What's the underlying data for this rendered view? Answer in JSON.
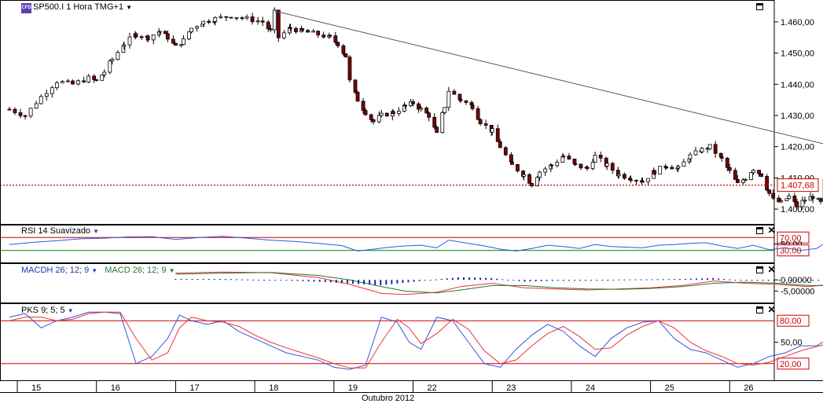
{
  "chart_data": [
    {
      "type": "candlestick",
      "title": "SP500.I 1 Hora TMG+1",
      "ylim": [
        1396,
        1465
      ],
      "y_ticks": [
        "1.460,00",
        "1.450,00",
        "1.440,00",
        "1.430,00",
        "1.420,00",
        "1.410,00",
        "1.400,00"
      ],
      "y_tick_values": [
        1460,
        1450,
        1440,
        1430,
        1420,
        1410,
        1400
      ],
      "last_price": 1407.68,
      "last_price_label": "1.407,68",
      "trendline": [
        [
          18.25,
          1463.5
        ],
        [
          26.8,
          1411
        ]
      ],
      "colors": {
        "bull": "#ffffff",
        "bear": "#7a0000",
        "wick": "#000000",
        "last_price": "#cc0000",
        "trendline": "#555555"
      },
      "close_path": [
        [
          14.9,
          1432
        ],
        [
          15.1,
          1430
        ],
        [
          15.3,
          1436
        ],
        [
          15.5,
          1441
        ],
        [
          15.7,
          1440
        ],
        [
          15.9,
          1442
        ],
        [
          16.0,
          1441
        ],
        [
          16.1,
          1444
        ],
        [
          16.2,
          1448
        ],
        [
          16.35,
          1453
        ],
        [
          16.5,
          1456
        ],
        [
          16.65,
          1455
        ],
        [
          16.8,
          1457
        ],
        [
          16.9,
          1455
        ],
        [
          17.0,
          1452
        ],
        [
          17.1,
          1454
        ],
        [
          17.2,
          1458
        ],
        [
          17.35,
          1460
        ],
        [
          17.5,
          1461
        ],
        [
          17.7,
          1462
        ],
        [
          17.9,
          1461
        ],
        [
          18.1,
          1460
        ],
        [
          18.2,
          1457
        ],
        [
          18.25,
          1463
        ],
        [
          18.3,
          1455
        ],
        [
          18.45,
          1458
        ],
        [
          18.6,
          1457
        ],
        [
          18.8,
          1456
        ],
        [
          18.95,
          1455
        ],
        [
          19.05,
          1453
        ],
        [
          19.15,
          1449
        ],
        [
          19.2,
          1441
        ],
        [
          19.3,
          1435
        ],
        [
          19.4,
          1431
        ],
        [
          19.5,
          1428
        ],
        [
          19.6,
          1430
        ],
        [
          19.75,
          1431
        ],
        [
          19.9,
          1433
        ],
        [
          20.0,
          1434
        ],
        [
          20.1,
          1432
        ],
        [
          20.2,
          1430
        ],
        [
          20.3,
          1424
        ],
        [
          20.4,
          1433
        ],
        [
          20.45,
          1438
        ],
        [
          20.6,
          1435
        ],
        [
          20.75,
          1433
        ],
        [
          20.85,
          1428
        ],
        [
          21.0,
          1425
        ],
        [
          21.1,
          1420
        ],
        [
          21.25,
          1414
        ],
        [
          21.4,
          1411
        ],
        [
          21.5,
          1408
        ],
        [
          21.6,
          1412
        ],
        [
          21.75,
          1414
        ],
        [
          21.9,
          1417
        ],
        [
          22.05,
          1414
        ],
        [
          22.2,
          1413
        ],
        [
          22.3,
          1417
        ],
        [
          22.45,
          1414
        ],
        [
          22.6,
          1411
        ],
        [
          22.75,
          1410
        ],
        [
          22.9,
          1409
        ],
        [
          23.05,
          1412
        ],
        [
          23.2,
          1414
        ],
        [
          23.35,
          1413
        ],
        [
          23.5,
          1417
        ],
        [
          23.65,
          1419
        ],
        [
          23.75,
          1420
        ],
        [
          23.9,
          1416
        ],
        [
          24.0,
          1412
        ],
        [
          24.1,
          1408
        ],
        [
          24.2,
          1410
        ],
        [
          24.3,
          1413
        ],
        [
          24.4,
          1411
        ],
        [
          24.5,
          1405
        ],
        [
          24.55,
          1403
        ],
        [
          24.65,
          1402
        ],
        [
          24.75,
          1404
        ],
        [
          24.85,
          1401
        ],
        [
          24.95,
          1403
        ],
        [
          25.05,
          1404
        ],
        [
          25.15,
          1402
        ],
        [
          25.2,
          1409
        ],
        [
          25.3,
          1412
        ],
        [
          25.4,
          1407
        ],
        [
          25.45,
          1408
        ]
      ]
    },
    {
      "type": "line",
      "title": "RSI 14 Suavizado",
      "ylim": [
        0,
        100
      ],
      "y_ticks": [
        "70,00",
        "50,00",
        "30,00"
      ],
      "y_tick_values": [
        70,
        50,
        30
      ],
      "ref_lines": [
        {
          "value": 70,
          "color": "#cc0000"
        },
        {
          "value": 30,
          "color": "#008000"
        }
      ],
      "series": [
        {
          "name": "RSI",
          "color": "#3355dd",
          "x": [
            14.9,
            15.2,
            15.5,
            15.8,
            16.1,
            16.4,
            16.7,
            17.0,
            17.3,
            17.6,
            17.9,
            18.2,
            18.5,
            18.8,
            19.1,
            19.3,
            19.5,
            19.7,
            19.9,
            20.1,
            20.3,
            20.45,
            20.7,
            20.9,
            21.1,
            21.3,
            21.5,
            21.7,
            21.9,
            22.1,
            22.3,
            22.5,
            22.7,
            22.9,
            23.1,
            23.3,
            23.5,
            23.7,
            23.9,
            24.1,
            24.3,
            24.5,
            24.7,
            24.9,
            25.1,
            25.25,
            25.45
          ],
          "values": [
            48,
            55,
            60,
            66,
            68,
            72,
            73,
            64,
            70,
            74,
            68,
            62,
            58,
            52,
            45,
            28,
            34,
            40,
            44,
            46,
            38,
            62,
            52,
            44,
            34,
            28,
            36,
            46,
            42,
            36,
            48,
            42,
            40,
            38,
            46,
            48,
            52,
            54,
            44,
            36,
            46,
            32,
            38,
            30,
            36,
            60,
            52
          ]
        }
      ]
    },
    {
      "type": "line",
      "title": "MACDH 26; 12; 9",
      "title2": "MACD 26; 12; 9",
      "ylim": [
        -9,
        6
      ],
      "y_ticks": [
        "0,00000",
        "-5,00000"
      ],
      "y_tick_values": [
        0,
        -5
      ],
      "series": [
        {
          "name": "MACD",
          "color": "#ee3333",
          "x": [
            17.0,
            17.6,
            18.2,
            18.8,
            19.2,
            19.6,
            19.9,
            20.3,
            20.6,
            21.0,
            21.4,
            21.8,
            22.2,
            22.6,
            23.0,
            23.4,
            23.8,
            24.2,
            24.6,
            25.0,
            25.25,
            25.45
          ],
          "values": [
            3,
            3.5,
            3.2,
            1.0,
            -2.0,
            -6.0,
            -6.5,
            -5.5,
            -3.0,
            -1.5,
            -3.5,
            -4.0,
            -4.5,
            -4.0,
            -3.5,
            -2.5,
            -0.5,
            -1.5,
            -2.0,
            -3.0,
            -2.0,
            -0.5
          ]
        },
        {
          "name": "Signal",
          "color": "#227733",
          "x": [
            17.0,
            17.6,
            18.2,
            18.8,
            19.2,
            19.6,
            19.9,
            20.3,
            20.6,
            21.0,
            21.4,
            21.8,
            22.2,
            22.6,
            23.0,
            23.4,
            23.8,
            24.2,
            24.6,
            25.0,
            25.25,
            25.45
          ],
          "values": [
            2.5,
            3.0,
            3.3,
            2.0,
            0.0,
            -3.0,
            -5.0,
            -5.8,
            -4.5,
            -2.5,
            -2.5,
            -3.5,
            -4.0,
            -4.2,
            -3.8,
            -3.0,
            -1.5,
            -1.0,
            -1.5,
            -2.5,
            -2.5,
            -1.5
          ]
        }
      ]
    },
    {
      "type": "line",
      "title": "PKS 9; 5; 5",
      "ylim": [
        0,
        100
      ],
      "y_ticks": [
        "80,00",
        "50,00",
        "20,00"
      ],
      "y_tick_values": [
        80,
        50,
        20
      ],
      "ref_lines": [
        {
          "value": 80,
          "color": "#cc0000"
        },
        {
          "value": 20,
          "color": "#cc0000"
        }
      ],
      "series": [
        {
          "name": "%K",
          "color": "#3355dd",
          "x": [
            14.9,
            15.1,
            15.3,
            15.5,
            15.7,
            15.9,
            16.1,
            16.3,
            16.5,
            16.7,
            16.9,
            17.05,
            17.2,
            17.4,
            17.6,
            17.8,
            18.0,
            18.2,
            18.4,
            18.6,
            18.8,
            19.0,
            19.2,
            19.4,
            19.6,
            19.8,
            19.95,
            20.1,
            20.3,
            20.5,
            20.7,
            20.9,
            21.1,
            21.3,
            21.5,
            21.7,
            21.9,
            22.1,
            22.3,
            22.5,
            22.7,
            22.9,
            23.1,
            23.3,
            23.5,
            23.7,
            23.9,
            24.1,
            24.3,
            24.5,
            24.7,
            24.9,
            25.1,
            25.25,
            25.45
          ],
          "values": [
            85,
            90,
            70,
            80,
            85,
            92,
            92,
            90,
            20,
            30,
            55,
            88,
            80,
            75,
            80,
            65,
            55,
            45,
            35,
            30,
            25,
            15,
            12,
            18,
            85,
            78,
            50,
            40,
            85,
            80,
            50,
            20,
            15,
            40,
            60,
            75,
            65,
            45,
            30,
            55,
            70,
            78,
            80,
            55,
            40,
            35,
            25,
            15,
            20,
            30,
            35,
            45,
            45,
            55,
            62
          ]
        },
        {
          "name": "%D",
          "color": "#ee3333",
          "x": [
            14.9,
            15.1,
            15.3,
            15.5,
            15.7,
            15.9,
            16.1,
            16.3,
            16.5,
            16.7,
            16.9,
            17.05,
            17.2,
            17.4,
            17.6,
            17.8,
            18.0,
            18.2,
            18.4,
            18.6,
            18.8,
            19.0,
            19.2,
            19.4,
            19.6,
            19.8,
            19.95,
            20.1,
            20.3,
            20.5,
            20.7,
            20.9,
            21.1,
            21.3,
            21.5,
            21.7,
            21.9,
            22.1,
            22.3,
            22.5,
            22.7,
            22.9,
            23.1,
            23.3,
            23.5,
            23.7,
            23.9,
            24.1,
            24.3,
            24.5,
            24.7,
            24.9,
            25.1,
            25.25,
            25.45
          ],
          "values": [
            80,
            85,
            85,
            80,
            82,
            90,
            92,
            92,
            55,
            25,
            35,
            70,
            85,
            80,
            78,
            72,
            60,
            50,
            42,
            35,
            28,
            20,
            14,
            14,
            50,
            82,
            70,
            48,
            62,
            82,
            68,
            38,
            20,
            25,
            45,
            62,
            72,
            58,
            40,
            42,
            60,
            72,
            80,
            70,
            50,
            38,
            30,
            20,
            18,
            22,
            30,
            38,
            44,
            48,
            56
          ]
        }
      ]
    }
  ],
  "x_axis": {
    "labels": [
      "15",
      "16",
      "17",
      "18",
      "19",
      "22",
      "23",
      "24",
      "25",
      "26"
    ],
    "label_x": [
      15,
      16,
      17,
      18,
      19,
      20,
      21,
      22,
      23,
      24
    ],
    "month_label": "Outubro 2012"
  },
  "icons": {
    "symbol_icon": "cfd-icon",
    "dropdown": "chevron-down-icon",
    "maximize": "maximize-icon",
    "close": "close-icon"
  }
}
